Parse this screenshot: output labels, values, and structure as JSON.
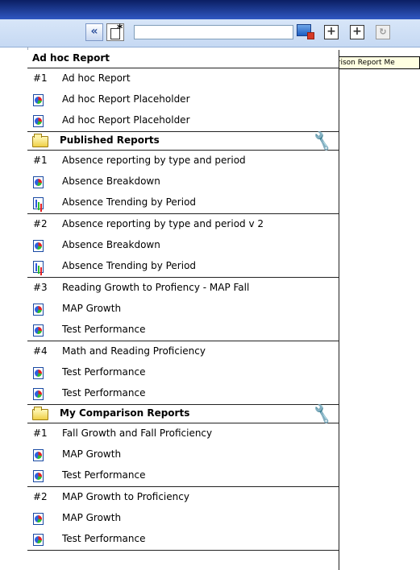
{
  "toolbar": {
    "search": {
      "value": "",
      "placeholder": ""
    },
    "collapse_glyph": "«",
    "add_glyph_1": "+",
    "add_glyph_2": "+",
    "refresh_glyph": "↻",
    "icons": [
      "collapse-double-arrow-icon",
      "new-report-icon",
      "comparison-report-icon",
      "add-box-icon",
      "add-box-icon",
      "refresh-icon"
    ]
  },
  "tooltip": {
    "text": "Comparison Report Me"
  },
  "adhoc": {
    "title": "Ad hoc Report",
    "items": [
      {
        "num": "#1",
        "label": "Ad hoc Report",
        "icon": ""
      },
      {
        "num": "",
        "label": "Ad hoc Report Placeholder",
        "icon": "pie-chart-icon"
      },
      {
        "num": "",
        "label": "Ad hoc Report Placeholder",
        "icon": "pie-chart-icon"
      }
    ]
  },
  "published": {
    "title": "Published Reports",
    "icons": [
      "folder-icon",
      "wrench-icon"
    ],
    "groups": [
      {
        "num": "#1",
        "label": "Absence reporting by type and period",
        "items": [
          {
            "label": "Absence Breakdown",
            "icon": "pie-chart-icon"
          },
          {
            "label": "Absence Trending by Period",
            "icon": "bar-chart-icon"
          }
        ]
      },
      {
        "num": "#2",
        "label": "Absence reporting by type and period v 2",
        "items": [
          {
            "label": "Absence Breakdown",
            "icon": "pie-chart-icon"
          },
          {
            "label": "Absence Trending by Period",
            "icon": "bar-chart-icon"
          }
        ]
      },
      {
        "num": "#3",
        "label": "Reading Growth to Profiency - MAP Fall",
        "items": [
          {
            "label": "MAP Growth",
            "icon": "pie-chart-icon"
          },
          {
            "label": "Test Performance",
            "icon": "pie-chart-icon"
          }
        ]
      },
      {
        "num": "#4",
        "label": "Math and Reading Proficiency",
        "items": [
          {
            "label": "Test Performance",
            "icon": "pie-chart-icon"
          },
          {
            "label": "Test Performance",
            "icon": "pie-chart-icon"
          }
        ]
      }
    ]
  },
  "comparison": {
    "title": "My Comparison Reports",
    "icons": [
      "folder-icon",
      "wrench-icon"
    ],
    "groups": [
      {
        "num": "#1",
        "label": "Fall Growth and Fall Proficiency",
        "items": [
          {
            "label": "MAP Growth",
            "icon": "pie-chart-icon"
          },
          {
            "label": "Test Performance",
            "icon": "pie-chart-icon"
          }
        ]
      },
      {
        "num": "#2",
        "label": "MAP Growth to Proficiency",
        "items": [
          {
            "label": "MAP Growth",
            "icon": "pie-chart-icon"
          },
          {
            "label": "Test Performance",
            "icon": "pie-chart-icon"
          }
        ]
      }
    ]
  }
}
